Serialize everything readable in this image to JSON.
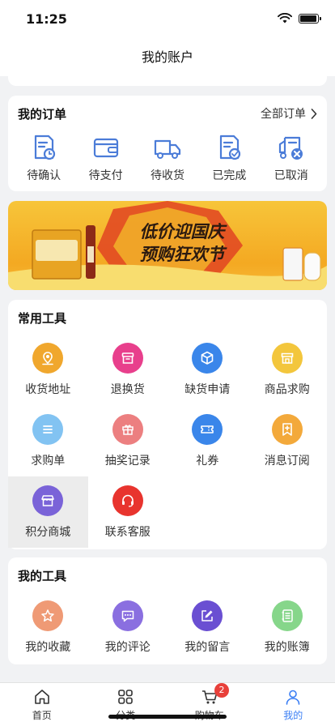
{
  "status": {
    "time": "11:25"
  },
  "header": {
    "title": "我的账户"
  },
  "orders": {
    "title": "我的订单",
    "all_label": "全部订单",
    "items": [
      {
        "label": "待确认",
        "icon": "doc-clock-icon"
      },
      {
        "label": "待支付",
        "icon": "wallet-icon"
      },
      {
        "label": "待收货",
        "icon": "truck-icon"
      },
      {
        "label": "已完成",
        "icon": "doc-check-icon"
      },
      {
        "label": "已取消",
        "icon": "truck-cancel-icon"
      }
    ]
  },
  "banner": {
    "line1": "低价迎国庆",
    "line2": "预购狂欢节"
  },
  "tools": {
    "title": "常用工具",
    "items": [
      {
        "label": "收货地址",
        "icon": "location-icon",
        "color": "#f0a72d"
      },
      {
        "label": "退换货",
        "icon": "box-icon",
        "color": "#e83f8c"
      },
      {
        "label": "缺货申请",
        "icon": "package-icon",
        "color": "#3a86ea"
      },
      {
        "label": "商品求购",
        "icon": "shop-icon",
        "color": "#f3c63c"
      },
      {
        "label": "求购单",
        "icon": "list-icon",
        "color": "#82c3f2"
      },
      {
        "label": "抽奖记录",
        "icon": "gift-icon",
        "color": "#ec7f80"
      },
      {
        "label": "礼券",
        "icon": "ticket-icon",
        "color": "#3a86ea"
      },
      {
        "label": "消息订阅",
        "icon": "bookmark-icon",
        "color": "#f3a93b"
      },
      {
        "label": "积分商城",
        "icon": "store-icon",
        "color": "#7a63d8"
      },
      {
        "label": "联系客服",
        "icon": "headset-icon",
        "color": "#e8342e"
      }
    ]
  },
  "mytools": {
    "title": "我的工具",
    "items": [
      {
        "label": "我的收藏",
        "icon": "star-icon",
        "color": "#ef9a75"
      },
      {
        "label": "我的评论",
        "icon": "comment-icon",
        "color": "#8a6fe0"
      },
      {
        "label": "我的留言",
        "icon": "edit-icon",
        "color": "#6a4fd2"
      },
      {
        "label": "我的账簿",
        "icon": "ledger-icon",
        "color": "#86d68a"
      }
    ]
  },
  "tabbar": {
    "items": [
      {
        "label": "首页",
        "icon": "home-icon"
      },
      {
        "label": "分类",
        "icon": "grid-icon"
      },
      {
        "label": "购物车",
        "icon": "cart-icon",
        "badge": "2"
      },
      {
        "label": "我的",
        "icon": "user-icon"
      }
    ]
  },
  "colors": {
    "accent": "#3a7ef4",
    "badge": "#e8403a"
  }
}
